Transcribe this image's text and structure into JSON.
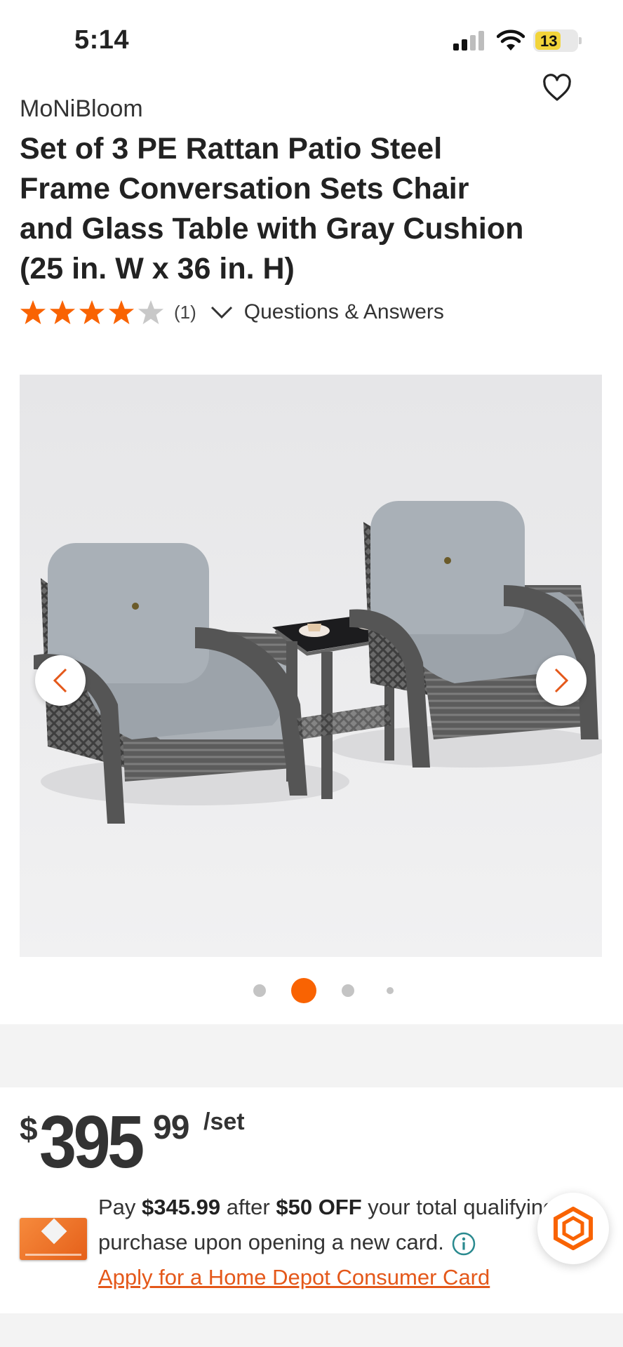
{
  "status_bar": {
    "time": "5:14",
    "battery_level": "13"
  },
  "product": {
    "brand": "MoNiBloom",
    "title": "Set of 3 PE Rattan Patio Steel Frame Conversation Sets Chair and Glass Table with Gray Cushion (25 in. W x 36 in. H)",
    "rating": 4,
    "rating_max": 5,
    "review_count": "(1)",
    "qa_label": "Questions & Answers"
  },
  "gallery": {
    "image_alt": "Two gray rattan patio chairs with gray cushions and a glass-top side table",
    "total_images": 4,
    "active_index": 1
  },
  "price": {
    "currency_symbol": "$",
    "dollars": "395",
    "cents": "99",
    "unit": "/set"
  },
  "promo": {
    "pay_text": "Pay ",
    "discount_price": "$345.99",
    "after_text": " after ",
    "off_amount": "$50 OFF",
    "total_text": " your total qualifying",
    "line2": "purchase upon opening a new card.",
    "apply_link": "Apply for a Home Depot Consumer Card"
  },
  "colors": {
    "accent": "#f96302",
    "link": "#e4581a",
    "star_empty": "#c8c8c8",
    "text": "#222222"
  },
  "icons": {
    "favorite": "heart-outline-icon",
    "star": "star-icon",
    "expand": "chevron-down-icon",
    "prev": "chevron-left-icon",
    "next": "chevron-right-icon",
    "info": "info-circle-icon",
    "help": "hexagon-help-icon"
  }
}
